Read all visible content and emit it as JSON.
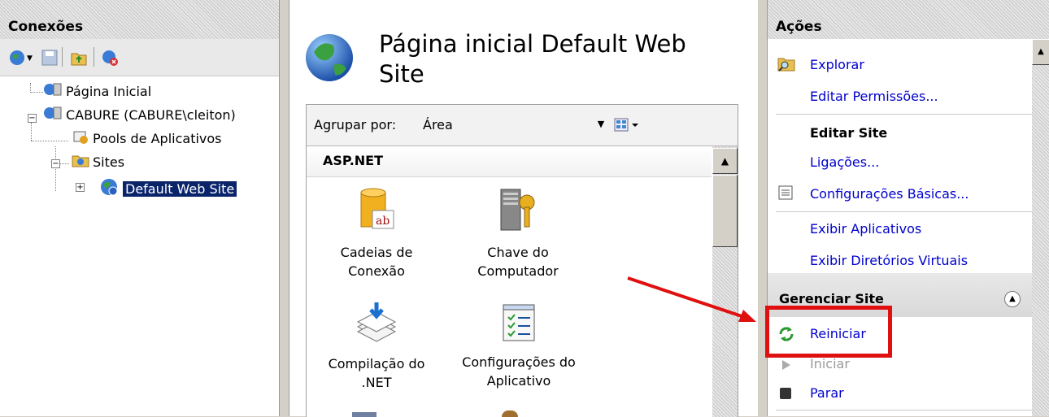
{
  "connections": {
    "title": "Conexões",
    "toolbar_icons": [
      "connect-icon",
      "dropdown-arrow-icon",
      "save-icon",
      "up-folder-icon",
      "disconnect-icon"
    ],
    "tree": [
      {
        "label": "Página Inicial",
        "icon": "server-icon"
      },
      {
        "label": "CABURE (CABURE\\cleiton)",
        "icon": "server-icon"
      },
      {
        "label": "Pools de Aplicativos",
        "icon": "app-pool-icon"
      },
      {
        "label": "Sites",
        "icon": "sites-folder-icon"
      },
      {
        "label": "Default Web Site",
        "icon": "globe-icon",
        "selected": true
      }
    ]
  },
  "main": {
    "title": "Página inicial Default Web Site",
    "group_by_label": "Agrupar por:",
    "group_by_value": "Área",
    "section": "ASP.NET",
    "features": [
      {
        "label_line1": "Cadeias de",
        "label_line2": "Conexão",
        "icon": "database-icon"
      },
      {
        "label_line1": "Chave do",
        "label_line2": "Computador",
        "icon": "machine-key-icon"
      },
      {
        "label_line1": "Compilação do",
        "label_line2": ".NET",
        "icon": "compilation-icon"
      },
      {
        "label_line1": "Configurações do",
        "label_line2": "Aplicativo",
        "icon": "app-settings-icon"
      }
    ]
  },
  "actions": {
    "title": "Ações",
    "explore": "Explorar",
    "edit_permissions": "Editar Permissões...",
    "edit_site_header": "Editar Site",
    "bindings": "Ligações...",
    "basic_settings": "Configurações Básicas...",
    "view_applications": "Exibir Aplicativos",
    "view_virtual_dirs": "Exibir Diretórios Virtuais",
    "manage_site_header": "Gerenciar Site",
    "restart": "Reiniciar",
    "start": "Iniciar",
    "stop": "Parar"
  },
  "colors": {
    "link": "#0000cc",
    "selection": "#0a246a",
    "annotation": "#e01010"
  }
}
